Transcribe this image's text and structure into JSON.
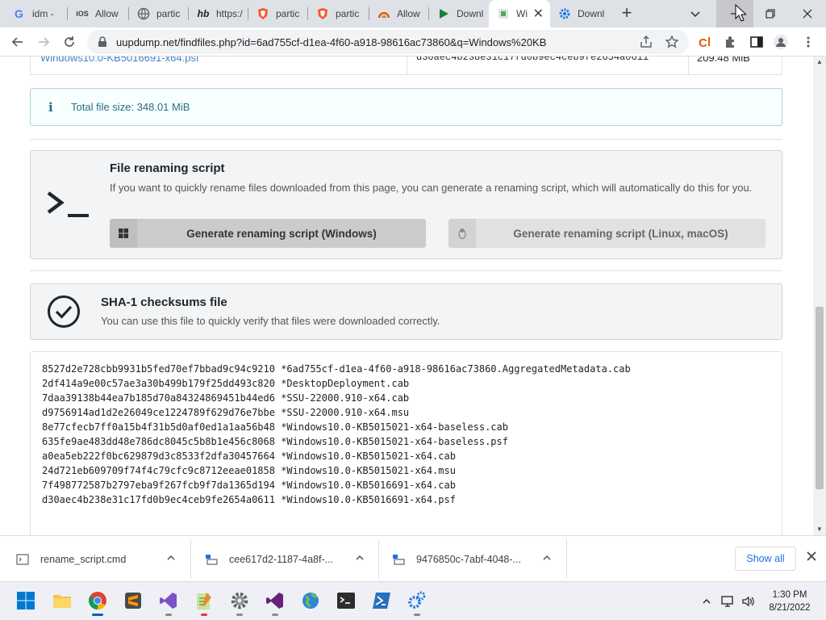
{
  "browser": {
    "tabs": [
      {
        "title": "idm - ",
        "favicon": "google-icon",
        "color": "#4285f4"
      },
      {
        "title": "Allow",
        "favicon": "ios-icon",
        "color": "#3c4043"
      },
      {
        "title": "partic",
        "favicon": "globe-icon",
        "color": "#5f6368"
      },
      {
        "title": "https:/",
        "favicon": "hb-icon",
        "color": "#202124"
      },
      {
        "title": "partic",
        "favicon": "brave-shield-icon",
        "color": "#fb542b"
      },
      {
        "title": "partic",
        "favicon": "brave-shield-icon",
        "color": "#fb542b"
      },
      {
        "title": "Allow",
        "favicon": "rainbow-icon",
        "color": "#e8710a"
      },
      {
        "title": "Downl",
        "favicon": "play-icon",
        "color": "#188038"
      },
      {
        "title": "Wi",
        "favicon": "uup-icon",
        "color": "#9aa0a6"
      },
      {
        "title": "Downl",
        "favicon": "gear-icon",
        "color": "#1a73e8"
      }
    ],
    "url": "uupdump.net/findfiles.php?id=6ad755cf-d1ea-4f60-a918-98616ac73860&q=Windows%20KB"
  },
  "file_table_fragment": {
    "name": "Windows10.0-KB5016691-x64.psf",
    "sha1": "d30aec4b238e31c17fd0b9ec4ceb9fe2654a0611",
    "size": "209.48 MiB"
  },
  "total_size": "Total file size: 348.01 MiB",
  "rename_section": {
    "title": "File renaming script",
    "description": "If you want to quickly rename files downloaded from this page, you can generate a renaming script, which will automatically do this for you.",
    "windows_button": "Generate renaming script (Windows)",
    "linux_button": "Generate renaming script (Linux, macOS)"
  },
  "checksum_section": {
    "title": "SHA-1 checksums file",
    "description": "You can use this file to quickly verify that files were downloaded correctly."
  },
  "checksums": [
    "8527d2e728cbb9931b5fed70ef7bbad9c94c9210 *6ad755cf-d1ea-4f60-a918-98616ac73860.AggregatedMetadata.cab",
    "2df414a9e00c57ae3a30b499b179f25dd493c820 *DesktopDeployment.cab",
    "7daa39138b44ea7b185d70a84324869451b44ed6 *SSU-22000.910-x64.cab",
    "d9756914ad1d2e26049ce1224789f629d76e7bbe *SSU-22000.910-x64.msu",
    "8e77cfecb7ff0a15b4f31b5d0af0ed1a1aa56b48 *Windows10.0-KB5015021-x64-baseless.cab",
    "635fe9ae483dd48e786dc8045c5b8b1e456c8068 *Windows10.0-KB5015021-x64-baseless.psf",
    "a0ea5eb222f0bc629879d3c8533f2dfa30457664 *Windows10.0-KB5015021-x64.cab",
    "24d721eb609709f74f4c79cfc9c8712eeae01858 *Windows10.0-KB5015021-x64.msu",
    "7f498772587b2797eba9f267fcb9f7da1365d194 *Windows10.0-KB5016691-x64.cab",
    "d30aec4b238e31c17fd0b9ec4ceb9fe2654a0611 *Windows10.0-KB5016691-x64.psf"
  ],
  "downloads": [
    {
      "name": "rename_script.cmd"
    },
    {
      "name": "cee617d2-1187-4a8f-..."
    },
    {
      "name": "9476850c-7abf-4048-..."
    }
  ],
  "show_all": "Show all",
  "clock": {
    "time": "1:30 PM",
    "date": "8/21/2022"
  },
  "colors": {
    "accent": "#1a73e8",
    "info_text": "#276f86",
    "segment_bg": "#f3f4f5"
  }
}
